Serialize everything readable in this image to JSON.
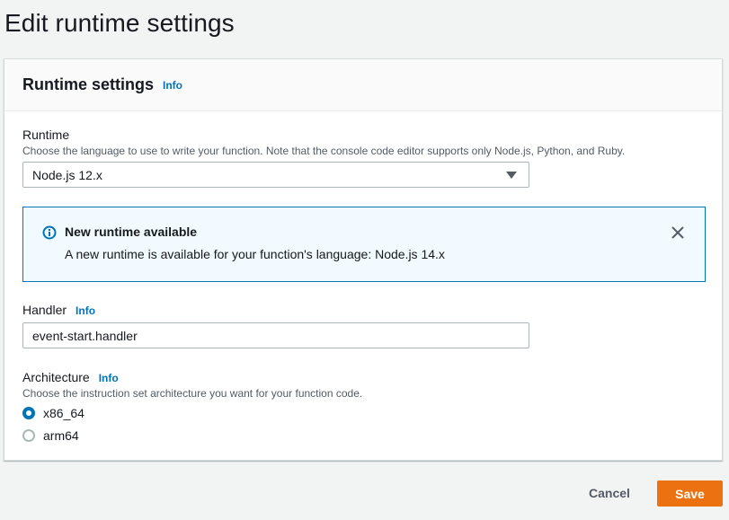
{
  "page": {
    "title": "Edit runtime settings"
  },
  "panel": {
    "title": "Runtime settings",
    "info_label": "Info"
  },
  "runtime": {
    "label": "Runtime",
    "description": "Choose the language to use to write your function. Note that the console code editor supports only Node.js, Python, and Ruby.",
    "selected_value": "Node.js 12.x",
    "caret_icon": "caret-down-icon"
  },
  "alert": {
    "icon": "info-circle-icon",
    "title": "New runtime available",
    "text": "A new runtime is available for your function's language: Node.js 14.x",
    "close_icon": "close-icon"
  },
  "handler": {
    "label": "Handler",
    "info_label": "Info",
    "value": "event-start.handler"
  },
  "architecture": {
    "label": "Architecture",
    "info_label": "Info",
    "description": "Choose the instruction set architecture you want for your function code.",
    "options": [
      {
        "label": "x86_64",
        "selected": true
      },
      {
        "label": "arm64",
        "selected": false
      }
    ]
  },
  "actions": {
    "cancel_label": "Cancel",
    "save_label": "Save"
  },
  "colors": {
    "accent": "#0073bb",
    "primary_button": "#ec7211",
    "alert_background": "#f1faff"
  }
}
